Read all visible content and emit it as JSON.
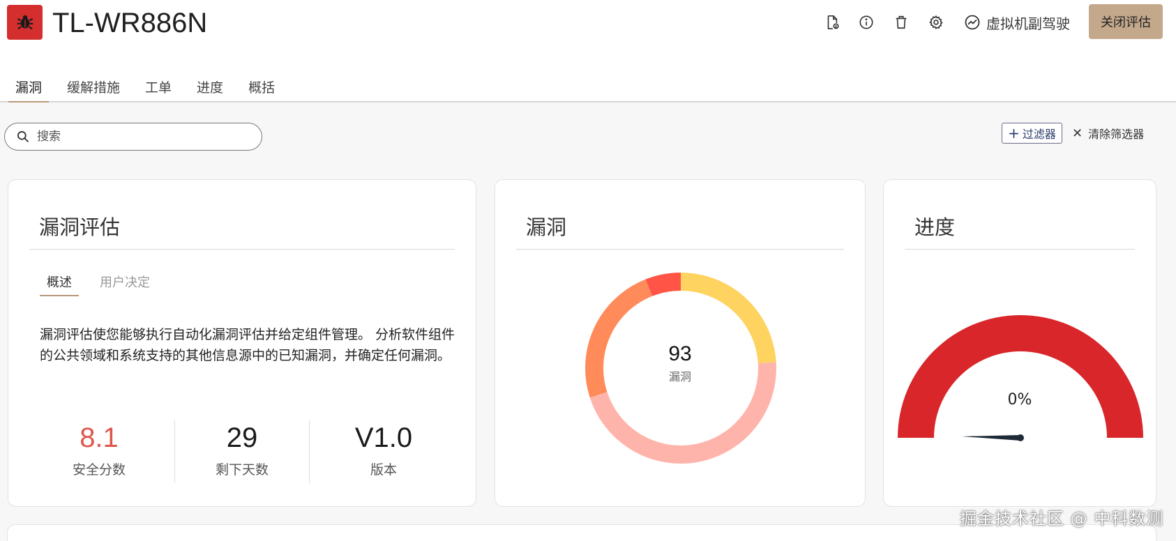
{
  "header": {
    "title": "TL-WR886N",
    "copilot_label": "虚拟机副驾驶",
    "close_label": "关闭评估"
  },
  "tabs": [
    {
      "label": "漏洞",
      "active": true
    },
    {
      "label": "缓解措施",
      "active": false
    },
    {
      "label": "工单",
      "active": false
    },
    {
      "label": "进度",
      "active": false
    },
    {
      "label": "概括",
      "active": false
    }
  ],
  "toolbar": {
    "search_placeholder": "搜索",
    "filter_label": "过滤器",
    "clear_label": "清除筛选器"
  },
  "assessment_card": {
    "title": "漏洞评估",
    "subtabs": [
      {
        "label": "概述",
        "active": true
      },
      {
        "label": "用户决定",
        "active": false
      }
    ],
    "description": "漏洞评估使您能够执行自动化漏洞评估并给定组件管理。 分析软件组件的公共领域和系统支持的其他信息源中的已知漏洞，并确定任何漏洞。",
    "metrics": [
      {
        "value": "8.1",
        "label": "安全分数"
      },
      {
        "value": "29",
        "label": "剩下天数"
      },
      {
        "value": "V1.0",
        "label": "版本"
      }
    ]
  },
  "vuln_card": {
    "title": "漏洞",
    "total": "93",
    "total_label": "漏洞",
    "segments": [
      {
        "fraction": 0.24,
        "color": "#ffd35f"
      },
      {
        "fraction": 0.46,
        "color": "#ffb4ab"
      },
      {
        "fraction": 0.24,
        "color": "#ff8a5a"
      },
      {
        "fraction": 0.06,
        "color": "#ff5446"
      }
    ]
  },
  "progress_card": {
    "title": "进度",
    "value_label": "0%",
    "value": 0,
    "color": "#d8262a"
  },
  "watermark": "掘金技术社区 @ 中科数测"
}
